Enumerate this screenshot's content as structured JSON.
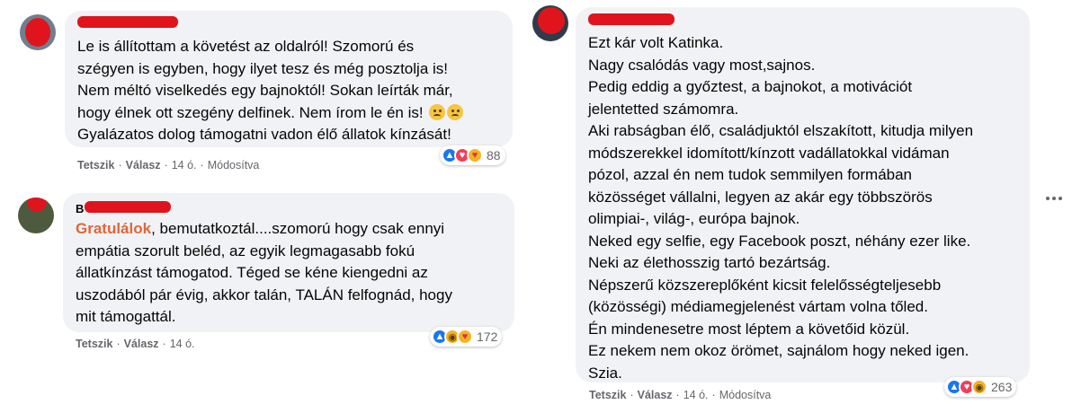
{
  "comments": [
    {
      "lines": [
        "Le is állítottam a követést az oldalról! Szomorú és",
        "szégyen is egyben, hogy ilyet tesz és még posztolja is!",
        "Nem méltó viselkedés egy bajnoktól! Sokan leírták már,",
        "hogy élnek ott szegény delfinek. Nem írom le én is!",
        "Gyalázatos dolog támogatni vadon élő állatok kínzását!"
      ],
      "like_label": "Tetszik",
      "reply_label": "Válasz",
      "time": "14 ó.",
      "edited": "Módosítva",
      "reaction_count": "88",
      "reaction_icons": [
        "like-icon",
        "love-icon",
        "care-icon"
      ]
    },
    {
      "name_initial": "B",
      "highlight": "Gratulálok",
      "first_line_rest": ", bemutatkoztál....szomorú hogy csak ennyi",
      "lines": [
        "empátia szorult beléd, az egyik legmagasabb fokú",
        "állatkínzást támogatod. Téged se kéne kiengedni az",
        "uszodából pár évig, akkor talán, TALÁN felfognád, hogy",
        "mit támogattál."
      ],
      "like_label": "Tetszik",
      "reply_label": "Válasz",
      "time": "14 ó.",
      "reaction_count": "172",
      "reaction_icons": [
        "like-icon",
        "haha-icon",
        "care-icon"
      ]
    },
    {
      "lines": [
        "Ezt kár volt Katinka.",
        "Nagy csalódás vagy most,sajnos.",
        "Pedig eddig a győztest, a bajnokot, a motivációt",
        "jelentetted számomra.",
        "Aki rabságban élő, családjuktól elszakított, kitudja milyen",
        "módszerekkel idomított/kínzott vadállatokkal vidáman",
        "pózol, azzal én nem tudok semmilyen formában",
        "közösséget vállalni, legyen az akár egy többszörös",
        "olimpiai-, világ-, európa bajnok.",
        "Neked egy selfie, egy Facebook poszt, néhány ezer like.",
        "Neki az élethosszig tartó bezártság.",
        "Népszerű közszereplőként kicsit felelősségteljesebb",
        "(közösségi) médiamegjelenést vártam volna tőled.",
        "Én mindenesetre most léptem a követőid közül.",
        "Ez nekem nem okoz örömet, sajnálom hogy neked igen.",
        "Szia."
      ],
      "like_label": "Tetszik",
      "reply_label": "Válasz",
      "time": "14 ó.",
      "edited": "Módosítva",
      "reaction_count": "263",
      "reaction_icons": [
        "like-icon",
        "love-icon",
        "haha-icon"
      ]
    }
  ],
  "colors": {
    "bubble": "#f0f2f5",
    "redaction": "#e0141c",
    "highlight": "#e0673a",
    "meta": "#65676b",
    "like": "#1877f2",
    "love": "#f33e58"
  }
}
